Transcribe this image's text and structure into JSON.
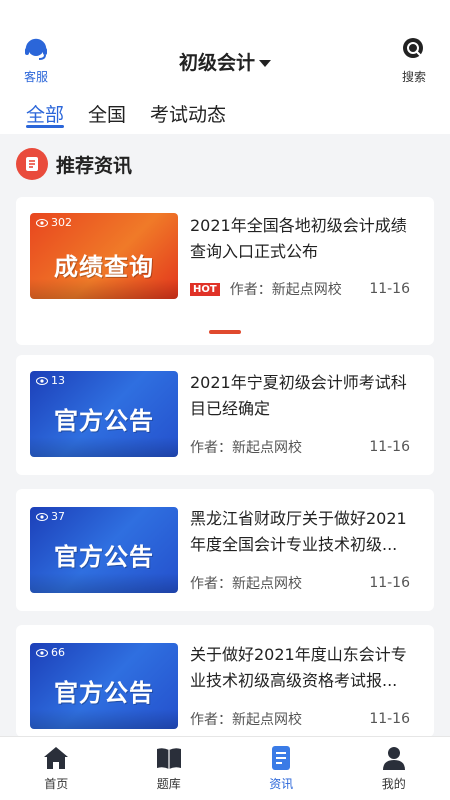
{
  "header": {
    "left_label": "客服",
    "title": "初级会计",
    "right_label": "搜索"
  },
  "tabs": [
    {
      "label": "全部",
      "active": true
    },
    {
      "label": "全国",
      "active": false
    },
    {
      "label": "考试动态",
      "active": false
    }
  ],
  "section": {
    "title": "推荐资讯",
    "icon": "news-icon"
  },
  "featured": {
    "views": "302",
    "thumb_text": "成绩查询",
    "title": "2021年全国各地初级会计成绩查询入口正式公布",
    "badge": "HOT",
    "author": "作者：新起点网校",
    "date": "11-16"
  },
  "articles": [
    {
      "views": "13",
      "thumb_text": "官方公告",
      "title": "2021年宁夏初级会计师考试科目已经确定",
      "author": "作者：新起点网校",
      "date": "11-16"
    },
    {
      "views": "37",
      "thumb_text": "官方公告",
      "title": "黑龙江省财政厅关于做好2021年度全国会计专业技术初级...",
      "author": "作者：新起点网校",
      "date": "11-16"
    },
    {
      "views": "66",
      "thumb_text": "官方公告",
      "title": "关于做好2021年度山东会计专业技术初级高级资格考试报...",
      "author": "作者：新起点网校",
      "date": "11-16"
    }
  ],
  "tabbar": [
    {
      "label": "首页",
      "icon": "home-icon",
      "active": false
    },
    {
      "label": "题库",
      "icon": "book-icon",
      "active": false
    },
    {
      "label": "资讯",
      "icon": "document-icon",
      "active": true
    },
    {
      "label": "我的",
      "icon": "user-icon",
      "active": false
    }
  ],
  "colors": {
    "accent": "#2b66d9",
    "hot": "#e03227",
    "section_icon": "#e94b3c"
  }
}
